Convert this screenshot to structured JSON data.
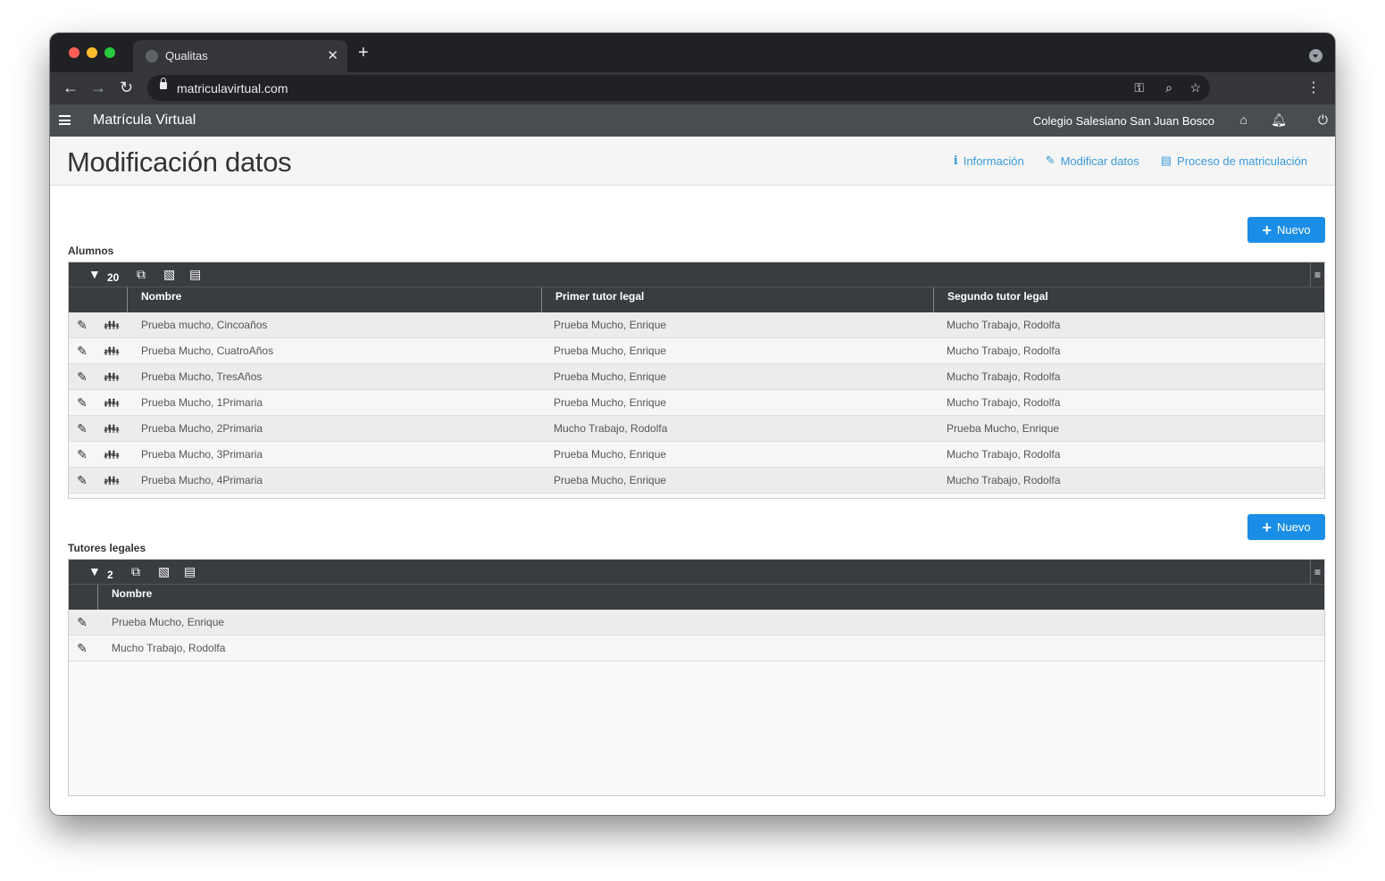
{
  "browser": {
    "tab_title": "Qualitas",
    "url": "matriculavirtual.com"
  },
  "app": {
    "title": "Matrícula Virtual",
    "school": "Colegio Salesiano San Juan Bosco"
  },
  "page": {
    "title": "Modificación datos",
    "links": [
      {
        "label": "Información",
        "icon": "info-icon"
      },
      {
        "label": "Modificar datos",
        "icon": "edit-icon"
      },
      {
        "label": "Proceso de matriculación",
        "icon": "id-card-icon"
      }
    ]
  },
  "alumnos": {
    "label": "Alumnos",
    "new_label": "Nuevo",
    "filter_count": "20",
    "columns": [
      "Nombre",
      "Primer tutor legal",
      "Segundo tutor legal"
    ],
    "rows": [
      [
        "Prueba mucho, Cincoaños",
        "Prueba Mucho, Enrique",
        "Mucho Trabajo, Rodolfa"
      ],
      [
        "Prueba Mucho, CuatroAños",
        "Prueba Mucho, Enrique",
        "Mucho Trabajo, Rodolfa"
      ],
      [
        "Prueba Mucho, TresAños",
        "Prueba Mucho, Enrique",
        "Mucho Trabajo, Rodolfa"
      ],
      [
        "Prueba Mucho, 1Primaria",
        "Prueba Mucho, Enrique",
        "Mucho Trabajo, Rodolfa"
      ],
      [
        "Prueba Mucho, 2Primaria",
        "Mucho Trabajo, Rodolfa",
        "Prueba Mucho, Enrique"
      ],
      [
        "Prueba Mucho, 3Primaria",
        "Prueba Mucho, Enrique",
        "Mucho Trabajo, Rodolfa"
      ],
      [
        "Prueba Mucho, 4Primaria",
        "Prueba Mucho, Enrique",
        "Mucho Trabajo, Rodolfa"
      ]
    ]
  },
  "tutores": {
    "label": "Tutores legales",
    "new_label": "Nuevo",
    "filter_count": "2",
    "columns": [
      "Nombre"
    ],
    "rows": [
      [
        "Prueba Mucho, Enrique"
      ],
      [
        "Mucho Trabajo, Rodolfa"
      ]
    ]
  },
  "colors": {
    "accent": "#1a8ee6",
    "link": "#3a9ad9",
    "header_dark": "#3a3d40"
  }
}
